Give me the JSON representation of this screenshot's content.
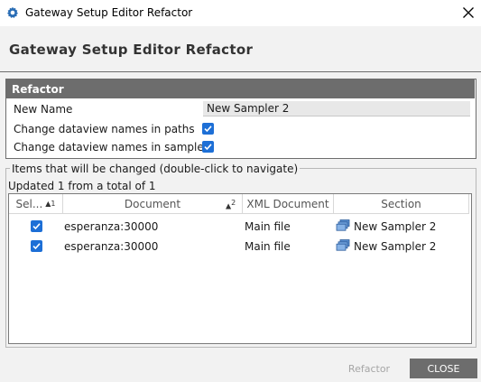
{
  "window": {
    "title": "Gateway Setup Editor Refactor"
  },
  "header": {
    "title": "Gateway Setup Editor Refactor"
  },
  "refactor": {
    "section_label": "Refactor",
    "new_name_label": "New Name",
    "new_name_value": "New Sampler 2",
    "paths_label": "Change dataview names in paths",
    "paths_checked": true,
    "samplers_label": "Change dataview names in samplers",
    "samplers_checked": true
  },
  "items": {
    "legend": "Items that will be changed (double-click to navigate)",
    "status": "Updated 1 from a total of 1",
    "columns": {
      "sel": "Sel...",
      "sel_sort": "1",
      "document": "Document",
      "document_sort": "2",
      "xml": "XML Document",
      "section": "Section"
    },
    "rows": [
      {
        "selected": true,
        "document": "esperanza:30000",
        "xml": "Main file",
        "section": "New Sampler 2"
      },
      {
        "selected": true,
        "document": "esperanza:30000",
        "xml": "Main file",
        "section": "New Sampler 2"
      }
    ]
  },
  "buttons": {
    "refactor": "Refactor",
    "close": "CLOSE"
  },
  "colors": {
    "accent": "#1d6fd6",
    "group_header": "#6d6d6d",
    "background": "#f2f2f2"
  },
  "icons": {
    "app": "gear-icon",
    "close": "close-icon",
    "section": "sampler-stack-icon"
  }
}
